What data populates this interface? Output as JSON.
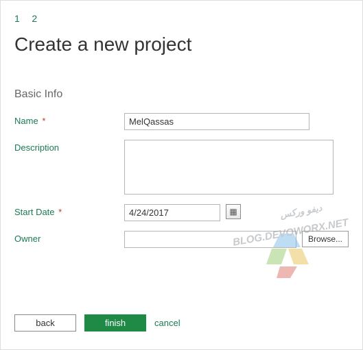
{
  "steps": {
    "s1": "1",
    "s2": "2"
  },
  "title": "Create a new project",
  "section": "Basic Info",
  "labels": {
    "name": "Name",
    "description": "Description",
    "startDate": "Start Date",
    "owner": "Owner",
    "req": "*"
  },
  "values": {
    "name": "MelQassas",
    "description": "",
    "startDate": "4/24/2017",
    "owner": ""
  },
  "buttons": {
    "back": "back",
    "finish": "finish",
    "cancel": "cancel",
    "browse": "Browse..."
  },
  "watermark": {
    "line1": "ديفو وركس",
    "line2": "BLOG.DEVOWORX.NET"
  }
}
